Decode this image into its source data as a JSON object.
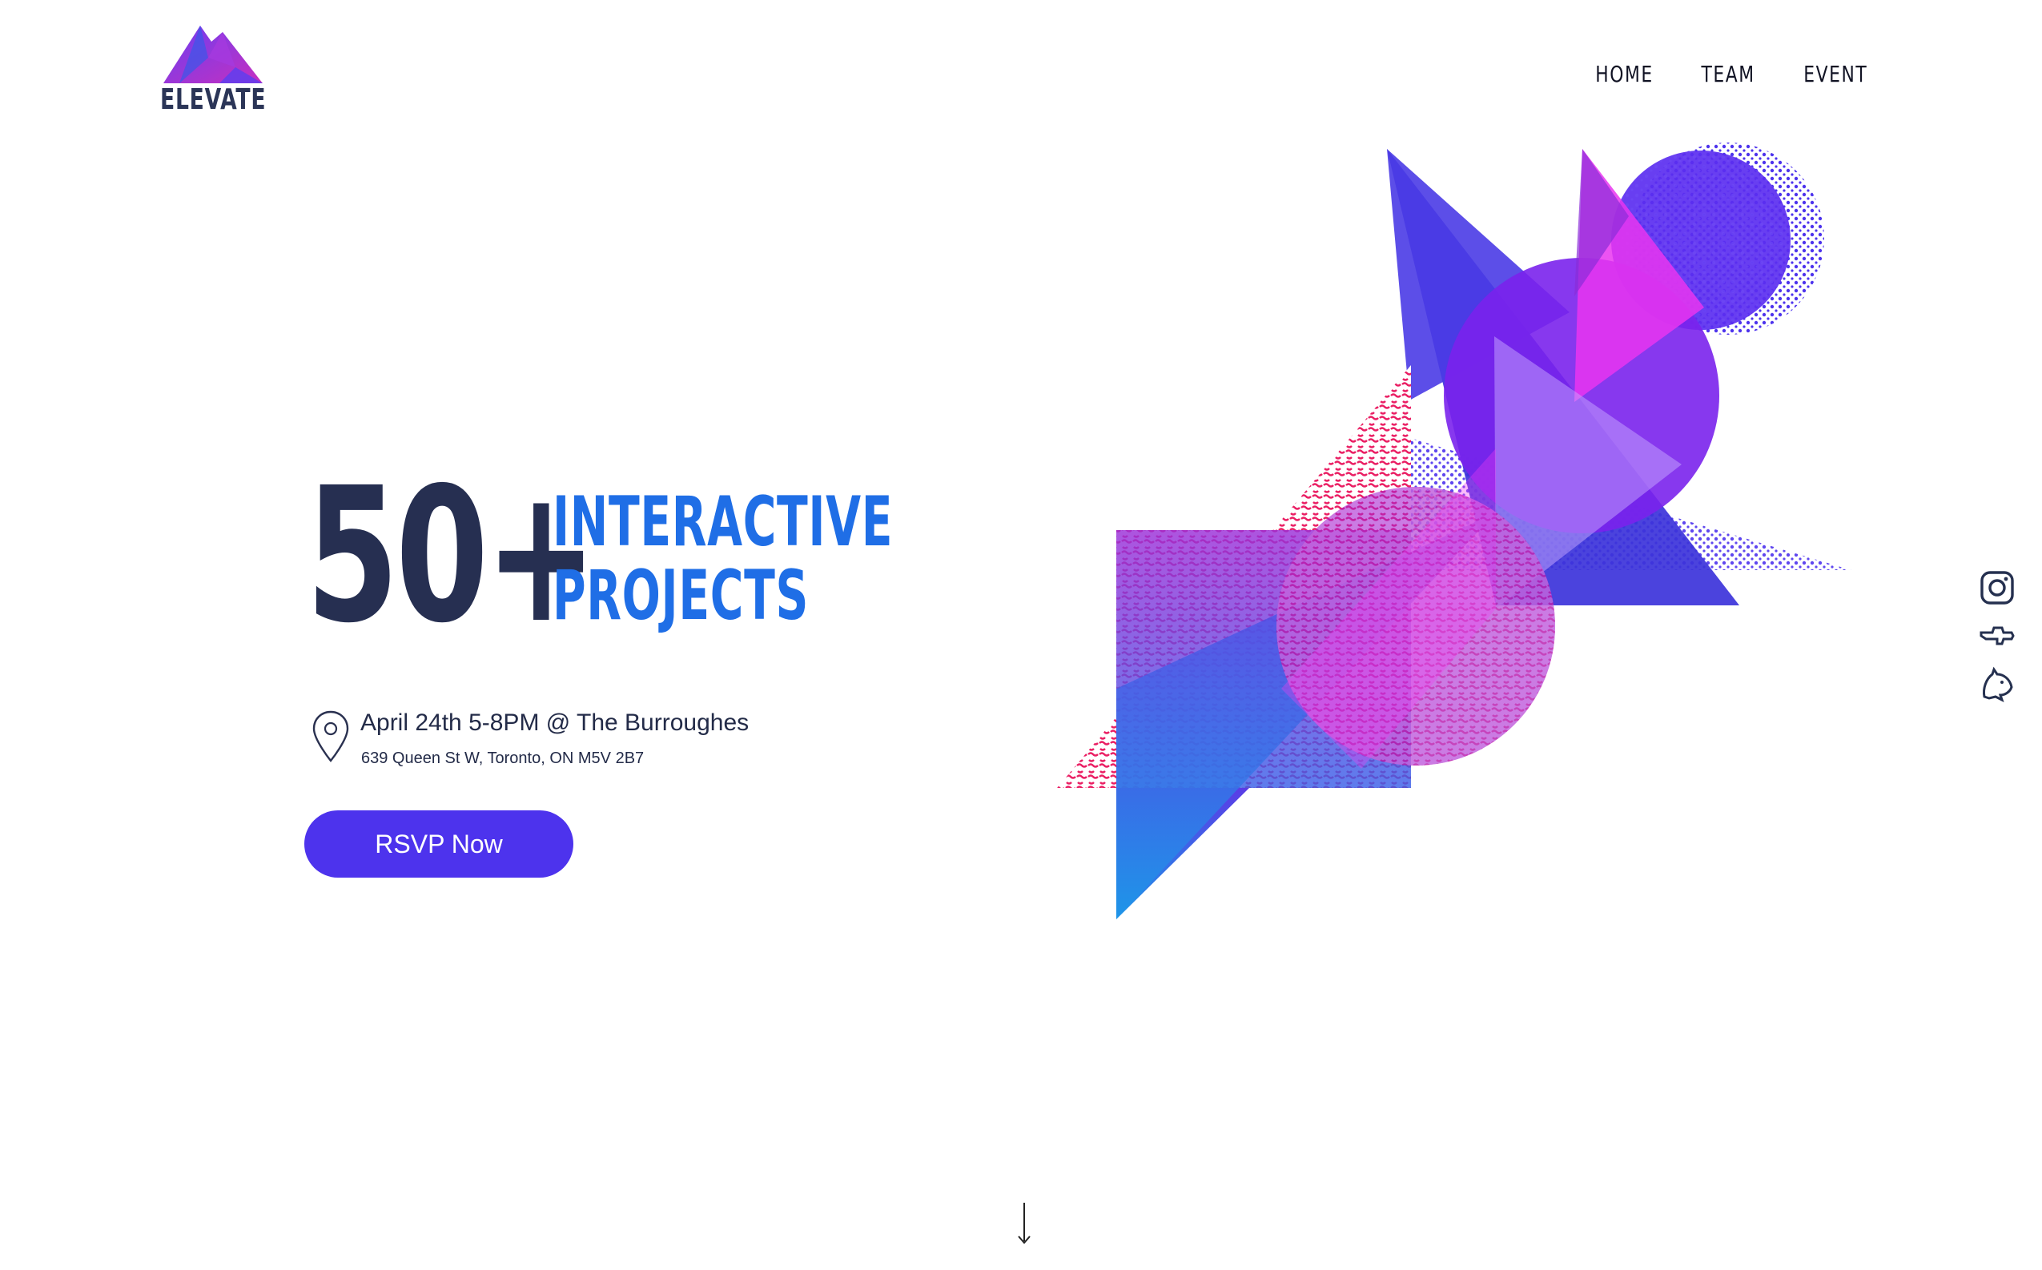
{
  "brand": {
    "name": "ELEVATE",
    "colors": {
      "primary": "#4d33ed",
      "accent_blue": "#1f6ee6",
      "navy": "#262f51",
      "magenta": "#e91e8c",
      "purple": "#7b2cf0"
    }
  },
  "nav": {
    "items": [
      {
        "label": "HOME"
      },
      {
        "label": "TEAM"
      },
      {
        "label": "EVENT"
      }
    ]
  },
  "hero": {
    "number": "50+",
    "line1": "INTERACTIVE",
    "line2": "PROJECTS",
    "event": "April 24th 5-8PM @ The Burroughes",
    "address": "639 Queen St W, Toronto, ON M5V 2B7",
    "cta_label": "RSVP Now"
  },
  "social": {
    "icons": [
      "instagram-icon",
      "airplane-icon",
      "bear-icon"
    ]
  },
  "icons": {
    "location": "location-pin-icon",
    "scroll": "scroll-down-arrow-icon"
  }
}
